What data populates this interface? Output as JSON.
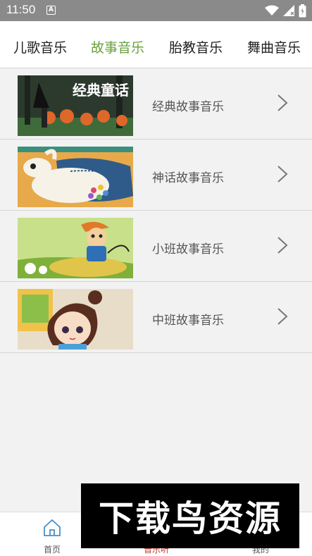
{
  "status_bar": {
    "time": "11:50",
    "notification_letter": "A"
  },
  "tabs": [
    {
      "label": "儿歌音乐",
      "active": false
    },
    {
      "label": "故事音乐",
      "active": true
    },
    {
      "label": "胎教音乐",
      "active": false
    },
    {
      "label": "舞曲音乐",
      "active": false
    }
  ],
  "list": [
    {
      "label": "经典故事音乐",
      "thumb_caption": "经典童话"
    },
    {
      "label": "神话故事音乐"
    },
    {
      "label": "小班故事音乐"
    },
    {
      "label": "中班故事音乐"
    }
  ],
  "bottom_nav": [
    {
      "label": "首页",
      "icon": "home-icon",
      "active": false
    },
    {
      "label": "音乐听",
      "icon": "music-icon",
      "active": true
    },
    {
      "label": "我的",
      "icon": "user-icon",
      "active": false
    }
  ],
  "watermark": {
    "text": "下载鸟资源"
  },
  "colors": {
    "accent": "#67a23c",
    "status_bar": "#8a8a8a",
    "background": "#f2f2f2",
    "nav_active": "#c0392b"
  }
}
